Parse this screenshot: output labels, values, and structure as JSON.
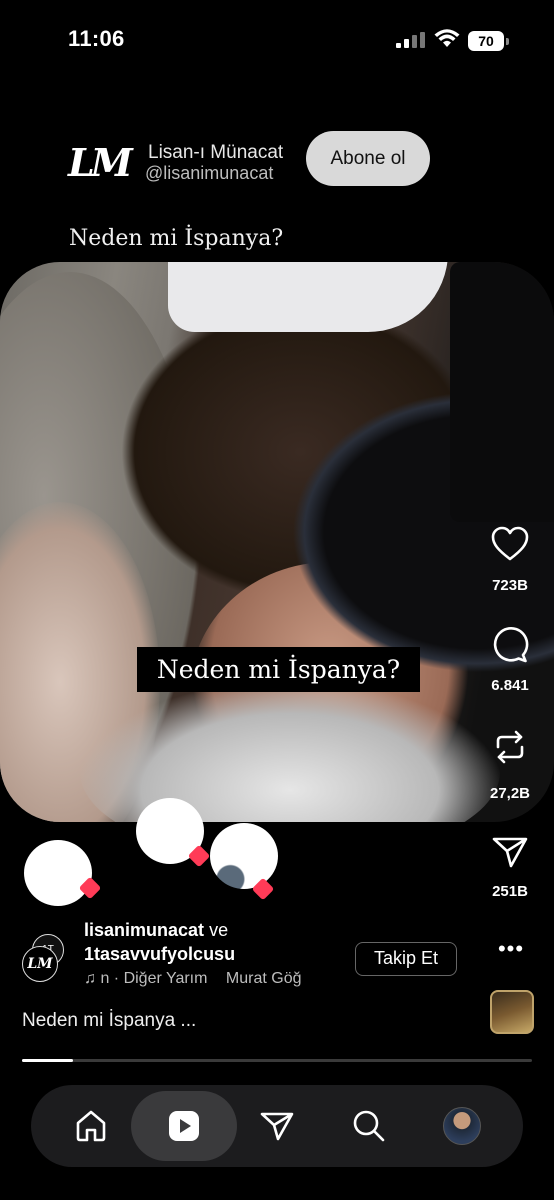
{
  "status_bar": {
    "time": "11:06",
    "battery": "70"
  },
  "channel": {
    "logo_text": "LM",
    "name": "Lisan-ı Münacat",
    "handle": "@lisanimunacat",
    "subscribe_label": "Abone ol"
  },
  "overlay_title": "Neden mi İspanya?",
  "video_caption": "Neden mi İspanya?",
  "rail": {
    "likes": "723B",
    "comments": "6.841",
    "reposts": "27,2B",
    "shares": "251B"
  },
  "info": {
    "author_primary": "lisanimunacat",
    "conjunction": "ve",
    "author_secondary": "1tasavvufyolcusu",
    "music_prefix": "n · Diğer Yarım",
    "music_artist": "Murat Göğ",
    "follow_label": "Takip Et",
    "caption": "Neden mi İspanya ...",
    "progress": 0.1
  },
  "colors": {
    "heart_badge": "#ff3b57",
    "subscribe_bg": "#d9d9d9",
    "nav_bg": "#1c1c1e"
  },
  "icons": [
    "heart-icon",
    "comment-icon",
    "repost-icon",
    "share-icon",
    "more-icon",
    "music-note-icon",
    "home-icon",
    "reels-icon",
    "send-icon",
    "search-icon"
  ]
}
